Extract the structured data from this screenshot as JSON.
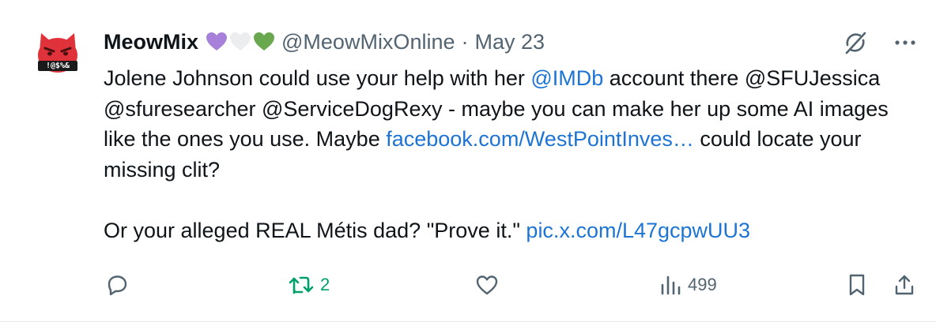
{
  "tweet": {
    "display_name": "MeowMix",
    "handle": "@MeowMixOnline",
    "separator": "·",
    "date": "May 23",
    "avatar_caption": "!@$%&",
    "hearts": [
      "purple-heart",
      "white-heart",
      "green-heart"
    ],
    "body": {
      "p1_t1": "Jolene Johnson could use your help with her ",
      "p1_mention": "@IMDb",
      "p1_t2": " account there @SFUJessica @sfuresearcher @ServiceDogRexy - maybe you can make her up some AI images like the ones you use. Maybe ",
      "p1_link": "facebook.com/WestPointInves…",
      "p1_t3": " could locate your missing clit?",
      "p2_t1": "Or your alleged REAL Métis dad? \"Prove it.\" ",
      "p2_link": "pic.x.com/L47gcpwUU3"
    }
  },
  "actions": {
    "retweet_count": "2",
    "views_count": "499"
  },
  "colors": {
    "link": "#1d74d4",
    "retweet": "#00a06a",
    "muted": "#536471",
    "avatar": "#e0323a"
  }
}
